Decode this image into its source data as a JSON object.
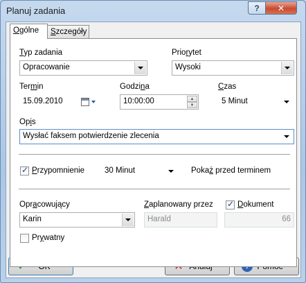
{
  "window": {
    "title": "Planuj zadania",
    "help_glyph": "?",
    "close_glyph": "✕"
  },
  "tabs": [
    {
      "pre": "",
      "u": "O",
      "post": "gólne"
    },
    {
      "pre": "",
      "u": "S",
      "post": "zczegóły"
    }
  ],
  "task_type": {
    "label_u": "T",
    "label_rest": "yp zadania",
    "value": "Opracowanie"
  },
  "priority": {
    "label_pre": "Prio",
    "label_u": "r",
    "label_post": "ytet",
    "value": "Wysoki"
  },
  "deadline": {
    "label_pre": "Ter",
    "label_u": "m",
    "label_post": "in",
    "value": "15.09.2010"
  },
  "time": {
    "label_pre": "Godzi",
    "label_u": "n",
    "label_post": "a",
    "value": "10:00:00"
  },
  "duration": {
    "label_u": "C",
    "label_rest": "zas",
    "value": "5 Minut"
  },
  "description": {
    "label_pre": "Op",
    "label_u": "i",
    "label_post": "s",
    "value": "Wysłać faksem potwierdzenie zlecenia"
  },
  "reminder": {
    "checked": true,
    "label_u": "P",
    "label_rest": "rzypomnienie",
    "value": "30 Minut",
    "after_pre": "Poka",
    "after_u": "ż",
    "after_post": " przed terminem"
  },
  "assignee": {
    "label_pre": "Opr",
    "label_u": "a",
    "label_post": "cowujący",
    "value": "Karin"
  },
  "scheduled_by": {
    "label_u": "Z",
    "label_rest": "aplanowany przez",
    "value": "Harald"
  },
  "document": {
    "checked": true,
    "label_u": "D",
    "label_rest": "okument",
    "value": "66"
  },
  "private": {
    "checked": false,
    "label_pre": "Pr",
    "label_u": "y",
    "label_post": "watny"
  },
  "buttons": {
    "ok": "OK",
    "cancel": "Anuluj",
    "help": "Pomoc"
  }
}
